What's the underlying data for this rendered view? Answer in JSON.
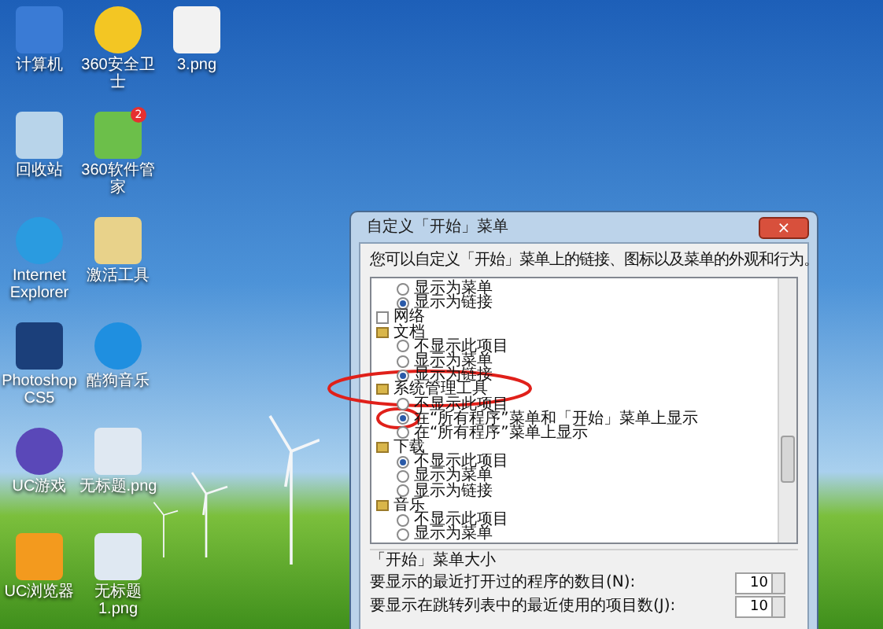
{
  "desktop": {
    "icons": [
      {
        "label": "计算机"
      },
      {
        "label": "360安全卫士"
      },
      {
        "label": "3.png"
      },
      {
        "label": "回收站"
      },
      {
        "label": "360软件管家",
        "badge": "2"
      },
      {
        "label": "Internet Explorer"
      },
      {
        "label": "激活工具"
      },
      {
        "label": "Photoshop CS5"
      },
      {
        "label": "酷狗音乐"
      },
      {
        "label": "UC游戏"
      },
      {
        "label": "无标题.png"
      },
      {
        "label": "UC浏览器"
      },
      {
        "label": "无标题1.png"
      }
    ]
  },
  "dialog": {
    "title": "自定义「开始」菜单",
    "close": "×",
    "description": "您可以自定义「开始」菜单上的链接、图标以及菜单的外观和行为。",
    "tree": [
      {
        "kind": "radio",
        "label": "显示为菜单",
        "selected": false
      },
      {
        "kind": "radio",
        "label": "显示为链接",
        "selected": true
      },
      {
        "kind": "checkbox",
        "label": "网络",
        "checked": false
      },
      {
        "kind": "category",
        "label": "文档",
        "children": [
          {
            "kind": "radio",
            "label": "不显示此项目",
            "selected": false
          },
          {
            "kind": "radio",
            "label": "显示为菜单",
            "selected": false
          },
          {
            "kind": "radio",
            "label": "显示为链接",
            "selected": true
          }
        ]
      },
      {
        "kind": "category",
        "label": "系统管理工具",
        "children": [
          {
            "kind": "radio",
            "label": "不显示此项目",
            "selected": false
          },
          {
            "kind": "radio",
            "label": "在“所有程序”菜单和「开始」菜单上显示",
            "selected": true
          },
          {
            "kind": "radio",
            "label": "在“所有程序”菜单上显示",
            "selected": false
          }
        ]
      },
      {
        "kind": "category",
        "label": "下载",
        "children": [
          {
            "kind": "radio",
            "label": "不显示此项目",
            "selected": true
          },
          {
            "kind": "radio",
            "label": "显示为菜单",
            "selected": false
          },
          {
            "kind": "radio",
            "label": "显示为链接",
            "selected": false
          }
        ]
      },
      {
        "kind": "category",
        "label": "音乐",
        "children": [
          {
            "kind": "radio",
            "label": "不显示此项目",
            "selected": false
          },
          {
            "kind": "radio",
            "label": "显示为菜单",
            "selected": false
          }
        ]
      }
    ],
    "size_group": {
      "title": "「开始」菜单大小",
      "rows": [
        {
          "label": "要显示的最近打开过的程序的数目(N):",
          "value": "10"
        },
        {
          "label": "要显示在跳转列表中的最近使用的项目数(J):",
          "value": "10"
        }
      ]
    }
  }
}
